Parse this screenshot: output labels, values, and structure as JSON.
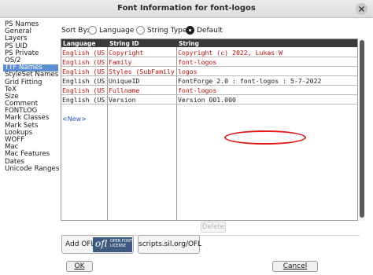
{
  "window": {
    "title": "Font Information for font-logos",
    "close_icon": "close-icon"
  },
  "sidebar": {
    "items": [
      {
        "label": "PS Names"
      },
      {
        "label": "General"
      },
      {
        "label": "Layers"
      },
      {
        "label": "PS UID"
      },
      {
        "label": "PS Private"
      },
      {
        "label": "OS/2"
      },
      {
        "label": "TTF Names",
        "selected": true
      },
      {
        "label": "StyleSet Names"
      },
      {
        "label": "Grid Fitting"
      },
      {
        "label": "TeX"
      },
      {
        "label": "Size"
      },
      {
        "label": "Comment"
      },
      {
        "label": "FONTLOG"
      },
      {
        "label": "Mark Classes"
      },
      {
        "label": "Mark Sets"
      },
      {
        "label": "Lookups"
      },
      {
        "label": "WOFF"
      },
      {
        "label": "Mac"
      },
      {
        "label": "Mac Features"
      },
      {
        "label": "Dates"
      },
      {
        "label": "Unicode Ranges"
      }
    ]
  },
  "sort": {
    "label": "Sort By:",
    "options": [
      "Language",
      "String Type",
      "Default"
    ],
    "selected": "Default"
  },
  "table": {
    "headers": [
      "Language",
      "String ID",
      "String"
    ],
    "rows": [
      {
        "language": "English (US)",
        "string_id": "Copyright",
        "string": "Copyright (c) 2022, Lukas W",
        "color": "red"
      },
      {
        "language": "English (US)",
        "string_id": "Family",
        "string": "font-logos",
        "color": "red"
      },
      {
        "language": "English (US)",
        "string_id": "Styles (SubFamily)",
        "string": "logos",
        "color": "red"
      },
      {
        "language": "English (US)",
        "string_id": "UniqueID",
        "string": "FontForge 2.0 : font-logos : 5-7-2022",
        "color": "black"
      },
      {
        "language": "English (US)",
        "string_id": "Fullname",
        "string": "font-logos",
        "color": "red"
      },
      {
        "language": "English (US)",
        "string_id": "Version",
        "string": "Version 001.000",
        "color": "black",
        "highlighted": true
      }
    ],
    "new_label": "<New>"
  },
  "buttons": {
    "delete": "Delete",
    "add_ofl": "Add OFL",
    "ofl_logo_text": "ofl",
    "ofl_logo_caption_1": "OPEN FONT",
    "ofl_logo_caption_2": "LICENSE",
    "sil_link": "scripts.sil.org/OFL",
    "ok": "OK",
    "cancel": "Cancel"
  },
  "colors": {
    "accent": "#5b8fd0",
    "red_text": "#c41010",
    "annotation": "#e01b1b",
    "header_bg": "#3a3a3a"
  }
}
